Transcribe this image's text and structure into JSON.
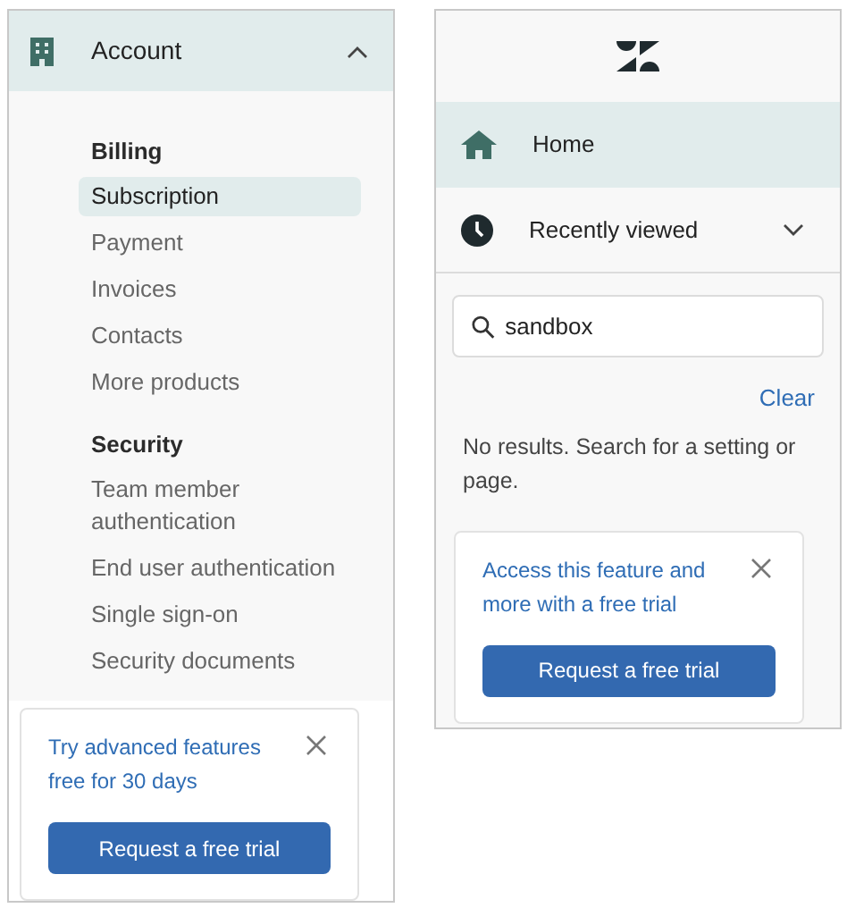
{
  "account_panel": {
    "header": {
      "label": "Account",
      "expanded": true
    },
    "sections": [
      {
        "title": "Billing",
        "items": [
          {
            "label": "Subscription",
            "selected": true
          },
          {
            "label": "Payment",
            "selected": false
          },
          {
            "label": "Invoices",
            "selected": false
          },
          {
            "label": "Contacts",
            "selected": false
          },
          {
            "label": "More products",
            "selected": false
          }
        ]
      },
      {
        "title": "Security",
        "items": [
          {
            "label": "Team member authentication",
            "selected": false
          },
          {
            "label": "End user authentication",
            "selected": false
          },
          {
            "label": "Single sign-on",
            "selected": false
          },
          {
            "label": "Security documents",
            "selected": false
          }
        ]
      }
    ],
    "promo": {
      "title": "Try advanced features free for 30 days",
      "button": "Request a free trial"
    }
  },
  "search_panel": {
    "nav": [
      {
        "label": "Home",
        "kind": "home",
        "selected": true
      },
      {
        "label": "Recently viewed",
        "kind": "recent",
        "selected": false,
        "expanded": false
      }
    ],
    "search": {
      "value": "sandbox"
    },
    "clear": "Clear",
    "message": "No results. Search for a setting or page.",
    "promo": {
      "title": "Access this feature and more with a free trial",
      "button": "Request a free trial"
    }
  }
}
